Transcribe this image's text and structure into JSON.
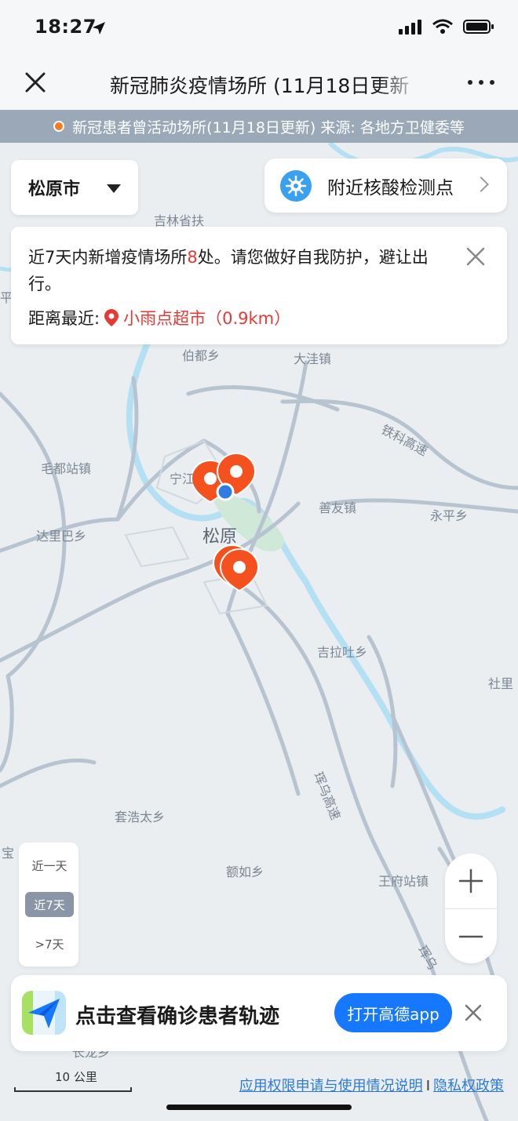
{
  "status_bar": {
    "time": "18:27"
  },
  "nav": {
    "title": "新冠肺炎疫情场所 (11月18日更新"
  },
  "info_strip": {
    "text": "新冠患者曾活动场所(11月18日更新)  来源: 各地方卫健委等"
  },
  "city_select": {
    "label": "松原市"
  },
  "nearby_test": {
    "label": "附近核酸检测点"
  },
  "notice": {
    "text_before": "近7天内新增疫情场所",
    "count": "8",
    "text_after": "处。请您做好自我防护，避让出行。",
    "nearest_label": "距离最近:",
    "nearest_place": "小雨点超市（0.9km）"
  },
  "map_labels": {
    "l1": "吉林省扶",
    "l2": "伯都乡",
    "l3": "大洼镇",
    "l4": "毛都站镇",
    "l5": "宁江",
    "l6": "善友镇",
    "l7": "永平乡",
    "l8": "达里巴乡",
    "l9": "松原",
    "l10": "吉拉吐乡",
    "l11": "社里",
    "l12": "套浩太乡",
    "l13": "额如乡",
    "l14": "王府站镇",
    "l15": "平凤",
    "l16": "宝",
    "l17": "长龙乡",
    "road1": "铁科高速",
    "road2": "珲乌高速",
    "road3": "珲乌"
  },
  "time_filter": {
    "options": [
      "近一天",
      "近7天",
      ">7天"
    ],
    "selected": "近7天"
  },
  "zoom": {
    "in": "+",
    "out": "−"
  },
  "banner": {
    "text": "点击查看确诊患者轨迹",
    "button": "打开高德app"
  },
  "scale": {
    "label": "10 公里"
  },
  "footer": {
    "link1": "应用权限申请与使用情况说明",
    "separator": "I",
    "link2": "隐私权政策"
  },
  "colors": {
    "accent_blue": "#1677ff",
    "alert_red": "#e53935",
    "marker_orange": "#f4511e",
    "strip_bg": "#9aa8b8"
  }
}
